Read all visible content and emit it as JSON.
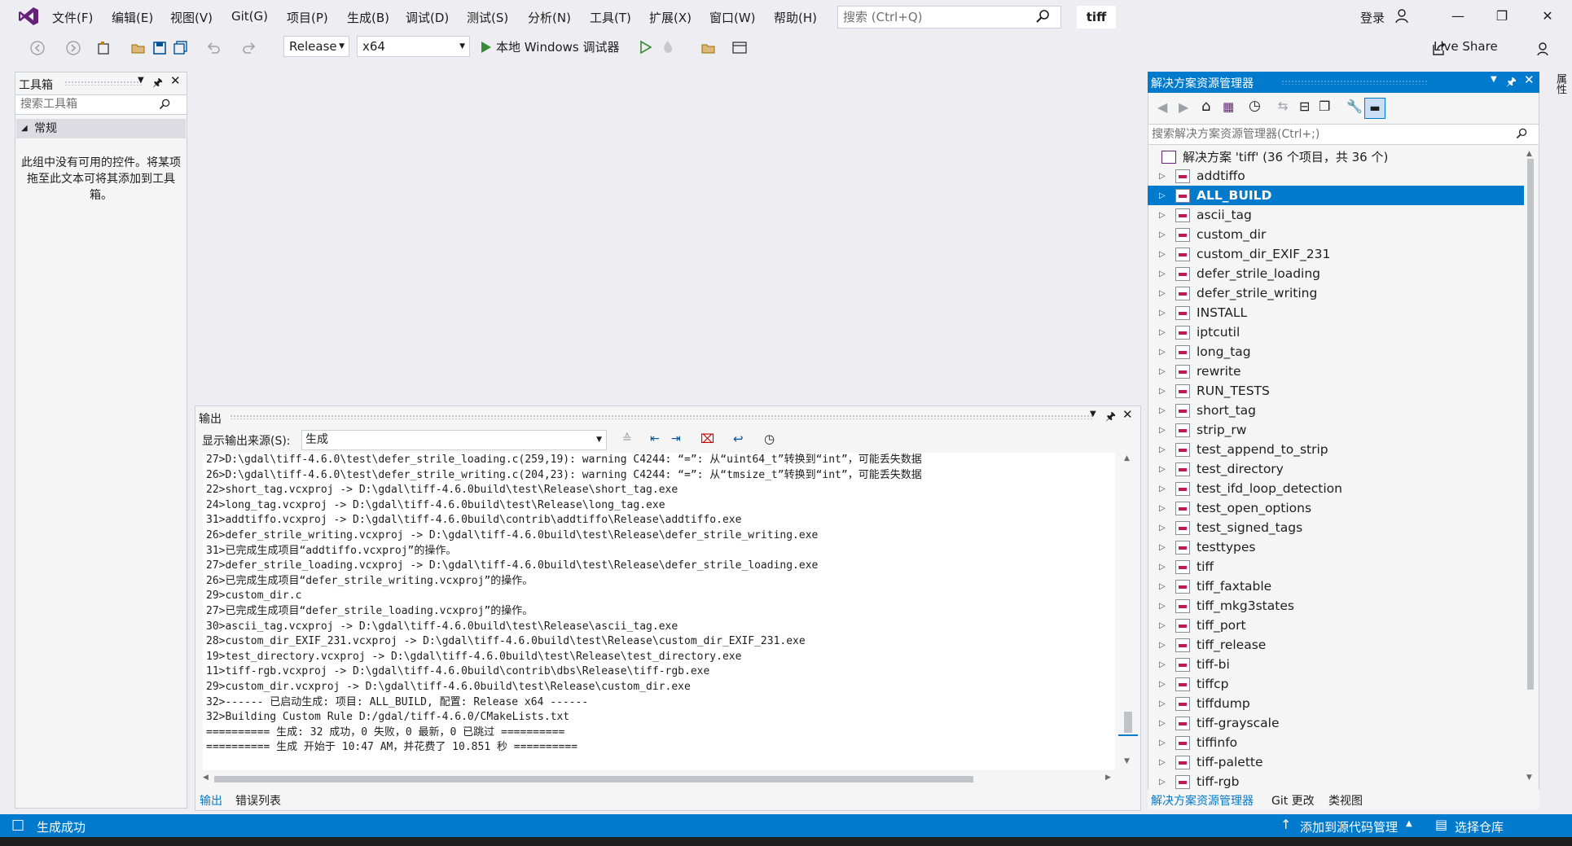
{
  "menu": {
    "items": [
      "文件(F)",
      "编辑(E)",
      "视图(V)",
      "Git(G)",
      "项目(P)",
      "生成(B)",
      "调试(D)",
      "测试(S)",
      "分析(N)",
      "工具(T)",
      "扩展(X)",
      "窗口(W)",
      "帮助(H)"
    ],
    "search_placeholder": "搜索 (Ctrl+Q)",
    "solution_name": "tiff",
    "login": "登录"
  },
  "toolbar": {
    "configuration": "Release",
    "platform": "x64",
    "run_label": "本地 Windows 调试器",
    "live_share": "Live Share"
  },
  "toolbox": {
    "title": "工具箱",
    "search_placeholder": "搜索工具箱",
    "group": "常规",
    "empty_text": "此组中没有可用的控件。将某项拖至此文本可将其添加到工具箱。"
  },
  "solution_explorer": {
    "title": "解决方案资源管理器",
    "search_placeholder": "搜索解决方案资源管理器(Ctrl+;)",
    "root": "解决方案 'tiff' (36 个项目，共 36 个)",
    "selected": "ALL_BUILD",
    "items": [
      "addtiffo",
      "ALL_BUILD",
      "ascii_tag",
      "custom_dir",
      "custom_dir_EXIF_231",
      "defer_strile_loading",
      "defer_strile_writing",
      "INSTALL",
      "iptcutil",
      "long_tag",
      "rewrite",
      "RUN_TESTS",
      "short_tag",
      "strip_rw",
      "test_append_to_strip",
      "test_directory",
      "test_ifd_loop_detection",
      "test_open_options",
      "test_signed_tags",
      "testtypes",
      "tiff",
      "tiff_faxtable",
      "tiff_mkg3states",
      "tiff_port",
      "tiff_release",
      "tiff-bi",
      "tiffcp",
      "tiffdump",
      "tiff-grayscale",
      "tiffinfo",
      "tiff-palette",
      "tiff-rgb"
    ],
    "tabs": [
      "解决方案资源管理器",
      "Git 更改",
      "类视图"
    ]
  },
  "right_edge": {
    "properties_label": "属性"
  },
  "output": {
    "title": "输出",
    "source_label": "显示输出来源(S):",
    "source_value": "生成",
    "lines": [
      "27>D:\\gdal\\tiff-4.6.0\\test\\defer_strile_loading.c(259,19): warning C4244: “=”: 从“uint64_t”转换到“int”，可能丢失数据",
      "26>D:\\gdal\\tiff-4.6.0\\test\\defer_strile_writing.c(204,23): warning C4244: “=”: 从“tmsize_t”转换到“int”，可能丢失数据",
      "22>short_tag.vcxproj -> D:\\gdal\\tiff-4.6.0build\\test\\Release\\short_tag.exe",
      "24>long_tag.vcxproj -> D:\\gdal\\tiff-4.6.0build\\test\\Release\\long_tag.exe",
      "31>addtiffo.vcxproj -> D:\\gdal\\tiff-4.6.0build\\contrib\\addtiffo\\Release\\addtiffo.exe",
      "26>defer_strile_writing.vcxproj -> D:\\gdal\\tiff-4.6.0build\\test\\Release\\defer_strile_writing.exe",
      "31>已完成生成项目“addtiffo.vcxproj”的操作。",
      "27>defer_strile_loading.vcxproj -> D:\\gdal\\tiff-4.6.0build\\test\\Release\\defer_strile_loading.exe",
      "26>已完成生成项目“defer_strile_writing.vcxproj”的操作。",
      "29>custom_dir.c",
      "27>已完成生成项目“defer_strile_loading.vcxproj”的操作。",
      "30>ascii_tag.vcxproj -> D:\\gdal\\tiff-4.6.0build\\test\\Release\\ascii_tag.exe",
      "28>custom_dir_EXIF_231.vcxproj -> D:\\gdal\\tiff-4.6.0build\\test\\Release\\custom_dir_EXIF_231.exe",
      "19>test_directory.vcxproj -> D:\\gdal\\tiff-4.6.0build\\test\\Release\\test_directory.exe",
      "11>tiff-rgb.vcxproj -> D:\\gdal\\tiff-4.6.0build\\contrib\\dbs\\Release\\tiff-rgb.exe",
      "29>custom_dir.vcxproj -> D:\\gdal\\tiff-4.6.0build\\test\\Release\\custom_dir.exe",
      "32>------ 已启动生成: 项目: ALL_BUILD, 配置: Release x64 ------",
      "32>Building Custom Rule D:/gdal/tiff-4.6.0/CMakeLists.txt",
      "========== 生成: 32 成功，0 失败，0 最新，0 已跳过 ==========",
      "========== 生成 开始于 10:47 AM，并花费了 10.851 秒 =========="
    ],
    "tabs": [
      "输出",
      "错误列表"
    ]
  },
  "statusbar": {
    "status": "生成成功",
    "add_source": "添加到源代码管理",
    "select_repo": "选择仓库"
  },
  "colors": {
    "accent": "#007acc",
    "background": "#eeeef2",
    "panel": "#f5f5f5",
    "logo": "#68217a"
  }
}
